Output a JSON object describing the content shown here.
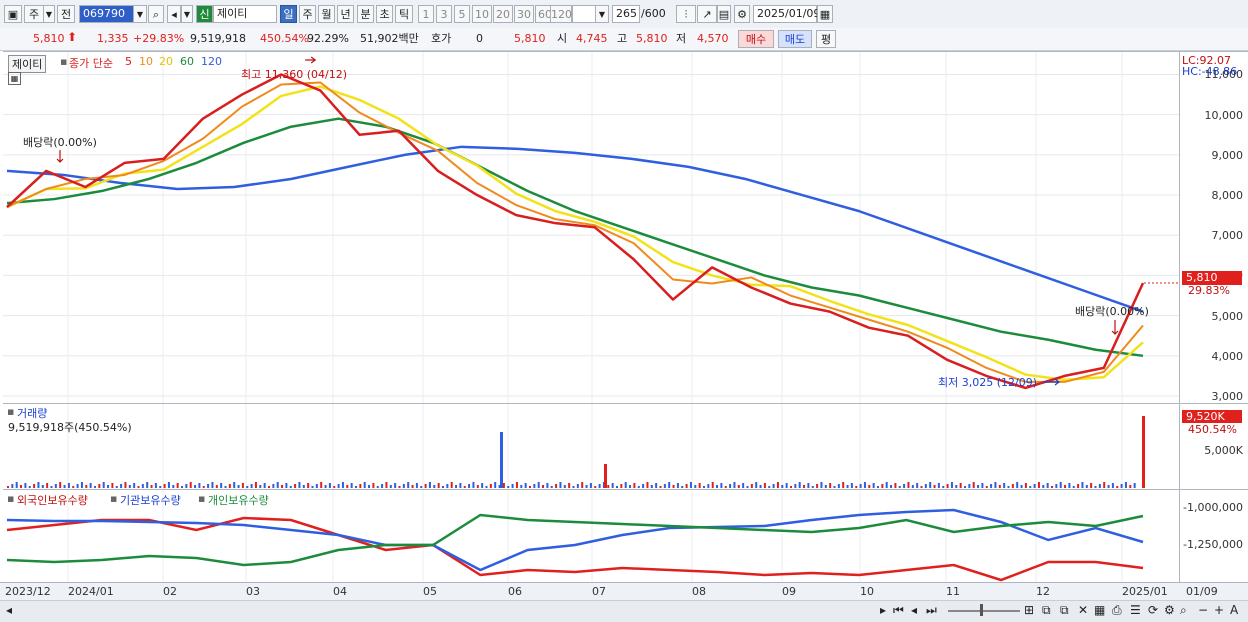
{
  "toolbar": {
    "market_mode": "주",
    "prev_label": "전",
    "code": "069790",
    "badge": "신",
    "stock_name": "제이티",
    "period_tabs": [
      "일",
      "주",
      "월",
      "년",
      "분",
      "초",
      "틱"
    ],
    "active_period": "일",
    "intervals": [
      "1",
      "3",
      "5",
      "10",
      "20",
      "30",
      "60",
      "120"
    ],
    "count": "265",
    "count_max": "/600",
    "date": "2025/01/09"
  },
  "quote": {
    "price": "5,810",
    "change": "1,335",
    "change_pct": "+29.83%",
    "volume": "9,519,918",
    "volume_pct": "450.54%",
    "turnover_pct": "92.29%",
    "amount": "51,902백만",
    "hoga_label": "호가",
    "hoga_value": "0",
    "hoga_price": "5,810",
    "open_label": "시",
    "open": "4,745",
    "high_label": "고",
    "high": "5,810",
    "low_label": "저",
    "low": "4,570",
    "buy_label": "매수",
    "sell_label": "매도",
    "eval_label": "평"
  },
  "price_pane": {
    "name_tag": "제이티",
    "ma_label": "종가 단순",
    "ma_periods": [
      "5",
      "10",
      "20",
      "60",
      "120"
    ],
    "ma_colors": [
      "#d81e1e",
      "#f08a1c",
      "#f2e21a",
      "#1c8c3c",
      "#2f5ee0"
    ],
    "high_note": "최고 11,360 (04/12)",
    "low_note": "최저 3,025 (12/09)",
    "div_note_left": "배당락(0.00%)",
    "div_note_right": "배당락(0.00%)",
    "lc": "LC:92.07",
    "hc": "HC:-48.86",
    "yticks": [
      "11,000",
      "10,000",
      "9,000",
      "8,000",
      "7,000",
      "6,000",
      "5,000",
      "4,000",
      "3,000"
    ],
    "last_price": "5,810",
    "last_pct": "29.83%"
  },
  "volume_pane": {
    "title": "거래량",
    "value": "9,519,918주(450.54%)",
    "tick": "5,000K",
    "last": "9,520K",
    "last_pct": "450.54%"
  },
  "holding_pane": {
    "series": [
      "외국인보유수량",
      "기관보유수량",
      "개인보유수량"
    ],
    "ticks": [
      "-1,000,000",
      "-1,250,000"
    ]
  },
  "xaxis": {
    "labels": [
      "2023/12",
      "2024/01",
      "02",
      "03",
      "04",
      "05",
      "06",
      "07",
      "08",
      "09",
      "10",
      "11",
      "12",
      "2025/01",
      "01/09"
    ]
  },
  "chart_data": {
    "type": "line",
    "title": "",
    "y_range": [
      3000,
      11360
    ],
    "series": [
      {
        "name": "종가 단순 5",
        "values": [
          7700,
          8600,
          8200,
          8800,
          8900,
          9900,
          10500,
          11000,
          10600,
          9500,
          9600,
          8600,
          8000,
          7500,
          7300,
          7200,
          6400,
          5400,
          6200,
          5700,
          5300,
          5100,
          4700,
          4500,
          3900,
          3500,
          3200,
          3500,
          3700,
          5810
        ]
      },
      {
        "name": "종가 단순 60",
        "values": [
          7800,
          7900,
          8100,
          8400,
          8800,
          9300,
          9700,
          9900,
          9700,
          9300,
          8700,
          8100,
          7600,
          7200,
          6800,
          6400,
          6000,
          5700,
          5500,
          5200,
          4900,
          4600,
          4400,
          4150,
          4000
        ]
      },
      {
        "name": "종가 단순 120",
        "values": [
          8600,
          8500,
          8300,
          8150,
          8200,
          8400,
          8700,
          9000,
          9200,
          9150,
          9050,
          8900,
          8700,
          8400,
          8000,
          7600,
          7100,
          6600,
          6100,
          5600,
          5100
        ]
      }
    ]
  }
}
